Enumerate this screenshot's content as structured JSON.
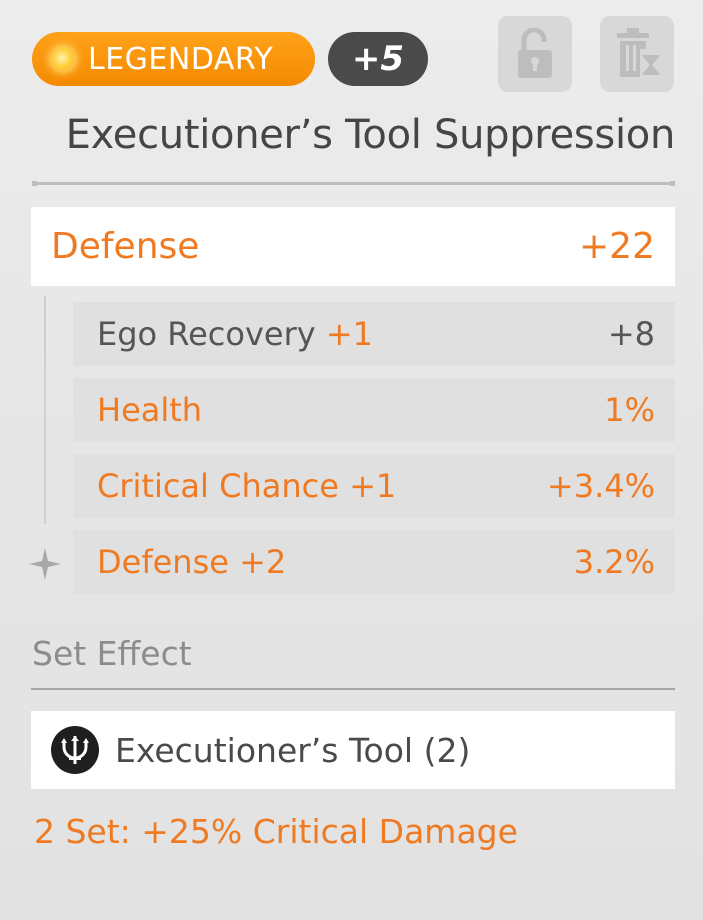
{
  "header": {
    "rarity_label": "LEGENDARY",
    "enhance_level": "+5",
    "lock_icon": "unlock-icon",
    "discard_icon": "trash-timer-icon"
  },
  "item": {
    "name": "Executioner’s Tool Suppression"
  },
  "main_stat": {
    "name": "Defense",
    "value": "+22"
  },
  "sub_stats": [
    {
      "name": "Ego Recovery",
      "bonus": "+1",
      "value": "+8",
      "highlight": false
    },
    {
      "name": "Health",
      "bonus": "",
      "value": "1%",
      "highlight": true
    },
    {
      "name": "Critical Chance",
      "bonus": "+1",
      "value": "+3.4%",
      "highlight": true
    },
    {
      "name": "Defense",
      "bonus": "+2",
      "value": "3.2%",
      "highlight": true
    }
  ],
  "set_effect": {
    "title": "Set Effect",
    "set_name": "Executioner’s Tool (2)",
    "icon": "trident-emblem-icon",
    "bonus_text": "2 Set: +25% Critical Damage"
  },
  "colors": {
    "accent_orange": "#f07a22",
    "legendary_orange": "#f48a00",
    "badge_dark": "#4a4a4a"
  }
}
